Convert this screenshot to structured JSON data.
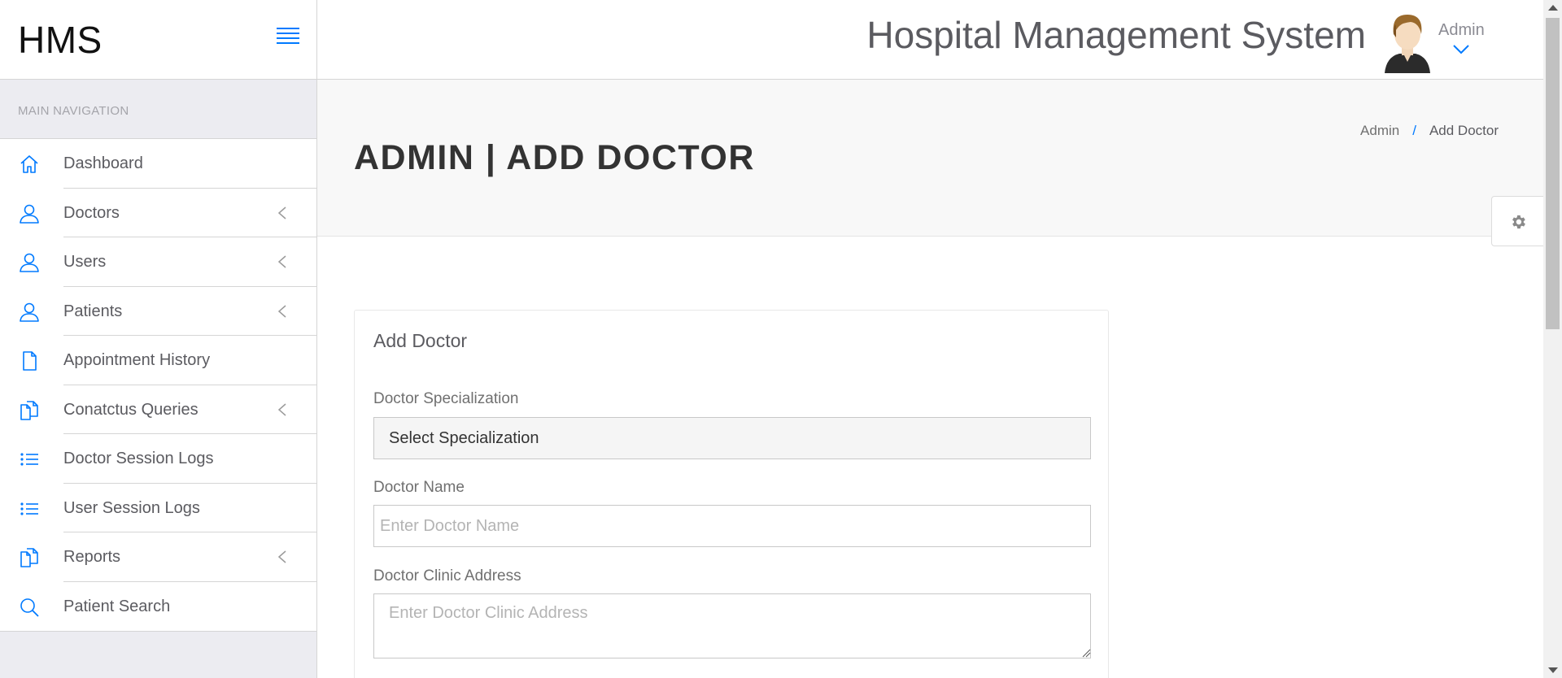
{
  "brand": "HMS",
  "app_title": "Hospital Management System",
  "user": {
    "name": "Admin"
  },
  "colors": {
    "accent": "#007aff",
    "sidebar_bg": "#ececf1",
    "text": "#5b5b60"
  },
  "sidebar": {
    "header": "MAIN NAVIGATION",
    "items": [
      {
        "label": "Dashboard",
        "icon": "home-icon",
        "expandable": false
      },
      {
        "label": "Doctors",
        "icon": "user-icon",
        "expandable": true
      },
      {
        "label": "Users",
        "icon": "user-icon",
        "expandable": true
      },
      {
        "label": "Patients",
        "icon": "user-icon",
        "expandable": true
      },
      {
        "label": "Appointment History",
        "icon": "file-icon",
        "expandable": false
      },
      {
        "label": "Conatctus Queries",
        "icon": "files-icon",
        "expandable": true
      },
      {
        "label": "Doctor Session Logs",
        "icon": "list-icon",
        "expandable": false
      },
      {
        "label": "User Session Logs",
        "icon": "list-icon",
        "expandable": false
      },
      {
        "label": "Reports",
        "icon": "files-icon",
        "expandable": true
      },
      {
        "label": "Patient Search",
        "icon": "search-icon",
        "expandable": false
      }
    ]
  },
  "page": {
    "title": "ADMIN | ADD DOCTOR",
    "breadcrumb": [
      "Admin",
      "Add Doctor"
    ]
  },
  "form": {
    "title": "Add Doctor",
    "specialization": {
      "label": "Doctor Specialization",
      "value": "Select Specialization"
    },
    "name": {
      "label": "Doctor Name",
      "placeholder": "Enter Doctor Name"
    },
    "address": {
      "label": "Doctor Clinic Address",
      "placeholder": "Enter Doctor Clinic Address"
    }
  }
}
